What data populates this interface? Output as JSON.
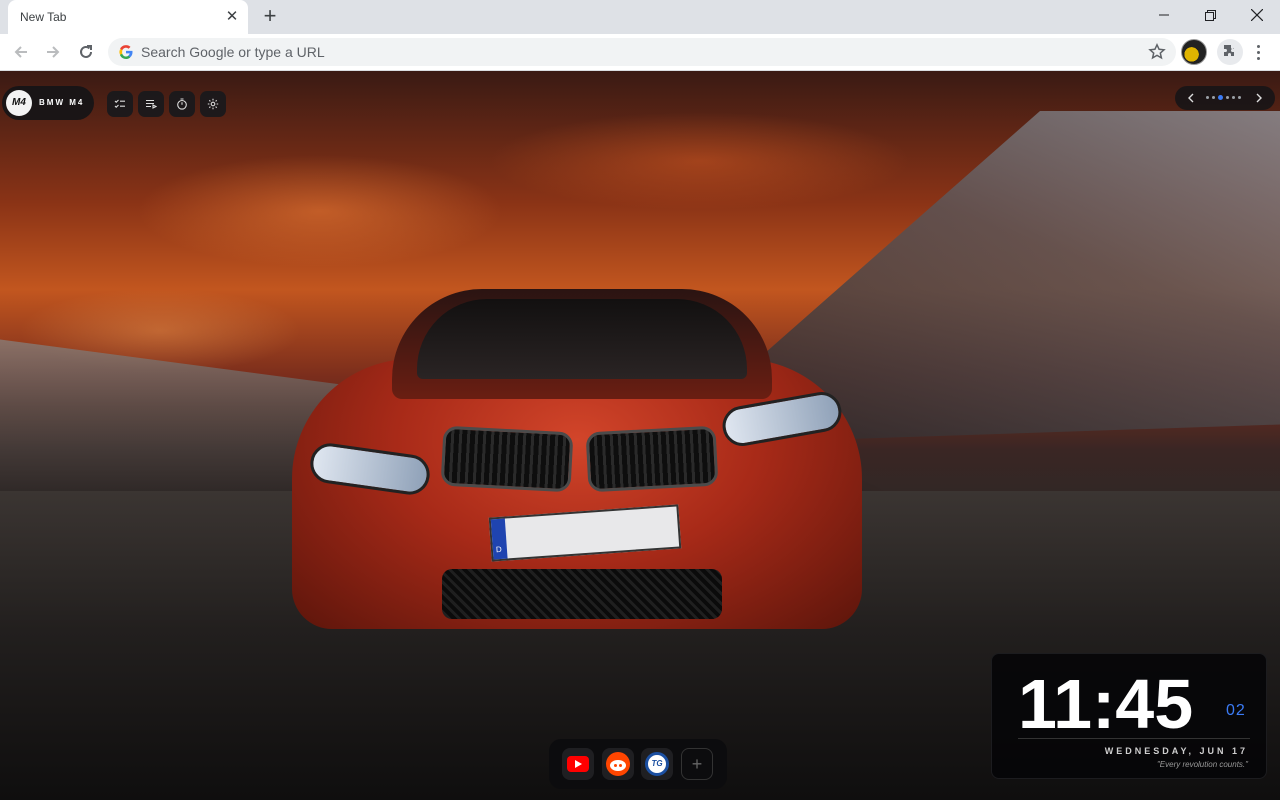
{
  "browser": {
    "tab_title": "New Tab",
    "omnibox_placeholder": "Search Google or type a URL"
  },
  "extension": {
    "brand_logo_text": "M4",
    "brand_name": "BMW M4",
    "tools": [
      {
        "icon": "checklist-icon"
      },
      {
        "icon": "notes-icon"
      },
      {
        "icon": "timer-icon"
      },
      {
        "icon": "gear-icon"
      }
    ],
    "wallpaper_dots": 6,
    "wallpaper_active_index": 3
  },
  "plate_country": "D",
  "dock": {
    "apps": [
      {
        "name": "youtube",
        "icon": "youtube-icon"
      },
      {
        "name": "reddit",
        "icon": "reddit-icon"
      },
      {
        "name": "tg",
        "icon": "tg-icon",
        "label": "TG"
      }
    ],
    "add_label": "+"
  },
  "clock": {
    "time": "11:45",
    "seconds": "02",
    "date": "WEDNESDAY, JUN 17",
    "quote": "\"Every revolution counts.\""
  },
  "colors": {
    "accent": "#3b7bf6",
    "youtube": "#ff0000",
    "reddit": "#ff4500",
    "tg": "#1b4fa1"
  }
}
